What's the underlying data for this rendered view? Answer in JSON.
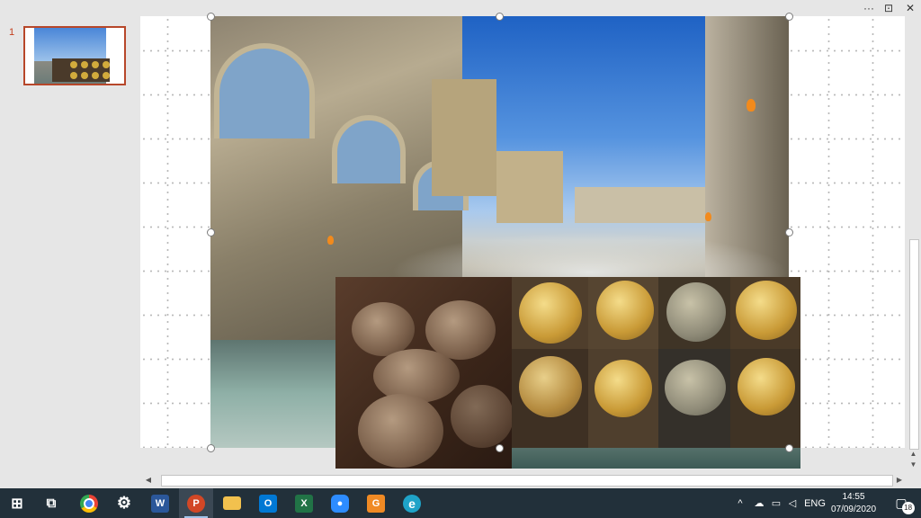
{
  "window": {
    "controls": [
      {
        "name": "more-options",
        "glyph": "···"
      },
      {
        "name": "ribbon-display",
        "glyph": "⊡"
      },
      {
        "name": "close",
        "glyph": "✕"
      }
    ]
  },
  "slides_pane": {
    "slides": [
      {
        "number": "1",
        "selected": true
      }
    ]
  },
  "slide": {
    "images": [
      {
        "name": "roman-baths-photo",
        "selected": true
      },
      {
        "name": "roman-coins-photo",
        "selected": false
      }
    ]
  },
  "taskbar": {
    "apps": [
      {
        "name": "start",
        "label": "⊞",
        "color": "#ffffff"
      },
      {
        "name": "task-view",
        "label": "⧉",
        "color": "#ffffff"
      },
      {
        "name": "chrome",
        "label": "",
        "color": "#4285f4"
      },
      {
        "name": "settings",
        "label": "⚙",
        "color": "#ffffff"
      },
      {
        "name": "word",
        "label": "W",
        "color": "#2b579a"
      },
      {
        "name": "powerpoint",
        "label": "P",
        "color": "#d24726",
        "active": true
      },
      {
        "name": "file-explorer",
        "label": "",
        "color": "#f2c14e"
      },
      {
        "name": "outlook",
        "label": "O",
        "color": "#0078d4"
      },
      {
        "name": "excel",
        "label": "X",
        "color": "#217346"
      },
      {
        "name": "zoom",
        "label": "●",
        "color": "#2d8cff"
      },
      {
        "name": "app-g",
        "label": "G",
        "color": "#f08a24"
      },
      {
        "name": "edge",
        "label": "e",
        "color": "#1fa3c8"
      }
    ],
    "tray": {
      "language": "ENG",
      "time": "14:55",
      "date": "07/09/2020",
      "notifications": "18"
    }
  },
  "colors": {
    "accent": "#b7472a",
    "taskbar": "#22303a"
  }
}
